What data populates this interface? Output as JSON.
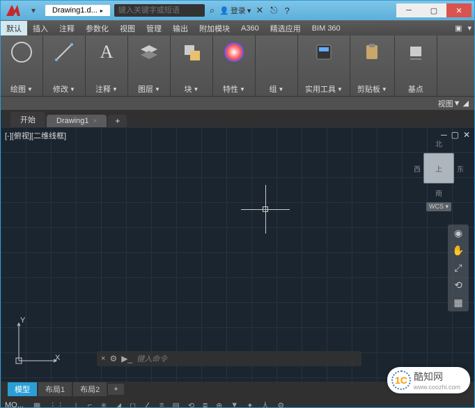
{
  "titlebar": {
    "doc_name": "Drawing1.d...",
    "search_placeholder": "键入关键字或短语",
    "login": "登录"
  },
  "menu": {
    "items": [
      "默认",
      "插入",
      "注释",
      "参数化",
      "视图",
      "管理",
      "输出",
      "附加模块",
      "A360",
      "精选应用",
      "BIM 360"
    ],
    "active_index": 0
  },
  "ribbon": {
    "panels": [
      {
        "label": "绘图",
        "icon": "draw"
      },
      {
        "label": "修改",
        "icon": "modify"
      },
      {
        "label": "注释",
        "icon": "text"
      },
      {
        "label": "图层",
        "icon": "layer"
      },
      {
        "label": "块",
        "icon": "block"
      },
      {
        "label": "特性",
        "icon": "props"
      },
      {
        "label": "组",
        "icon": "group"
      },
      {
        "label": "实用工具",
        "icon": "util"
      },
      {
        "label": "剪贴板",
        "icon": "clip"
      },
      {
        "label": "基点",
        "icon": "base"
      }
    ],
    "view_dd": "视图"
  },
  "doctabs": {
    "start": "开始",
    "drawing": "Drawing1"
  },
  "viewport": {
    "label": "[-][俯视][二维线框]",
    "viewcube": {
      "n": "北",
      "e": "东",
      "s": "南",
      "w": "西",
      "face": "上",
      "wcs": "WCS"
    },
    "ucs": {
      "x": "X",
      "y": "Y"
    }
  },
  "layout_tabs": [
    "模型",
    "布局1",
    "布局2"
  ],
  "cmdline": {
    "prompt": "键入命令"
  },
  "statusbar": {
    "text": "MO..."
  },
  "watermark": {
    "brand": "酷知网",
    "url": "www.coozhi.com"
  }
}
